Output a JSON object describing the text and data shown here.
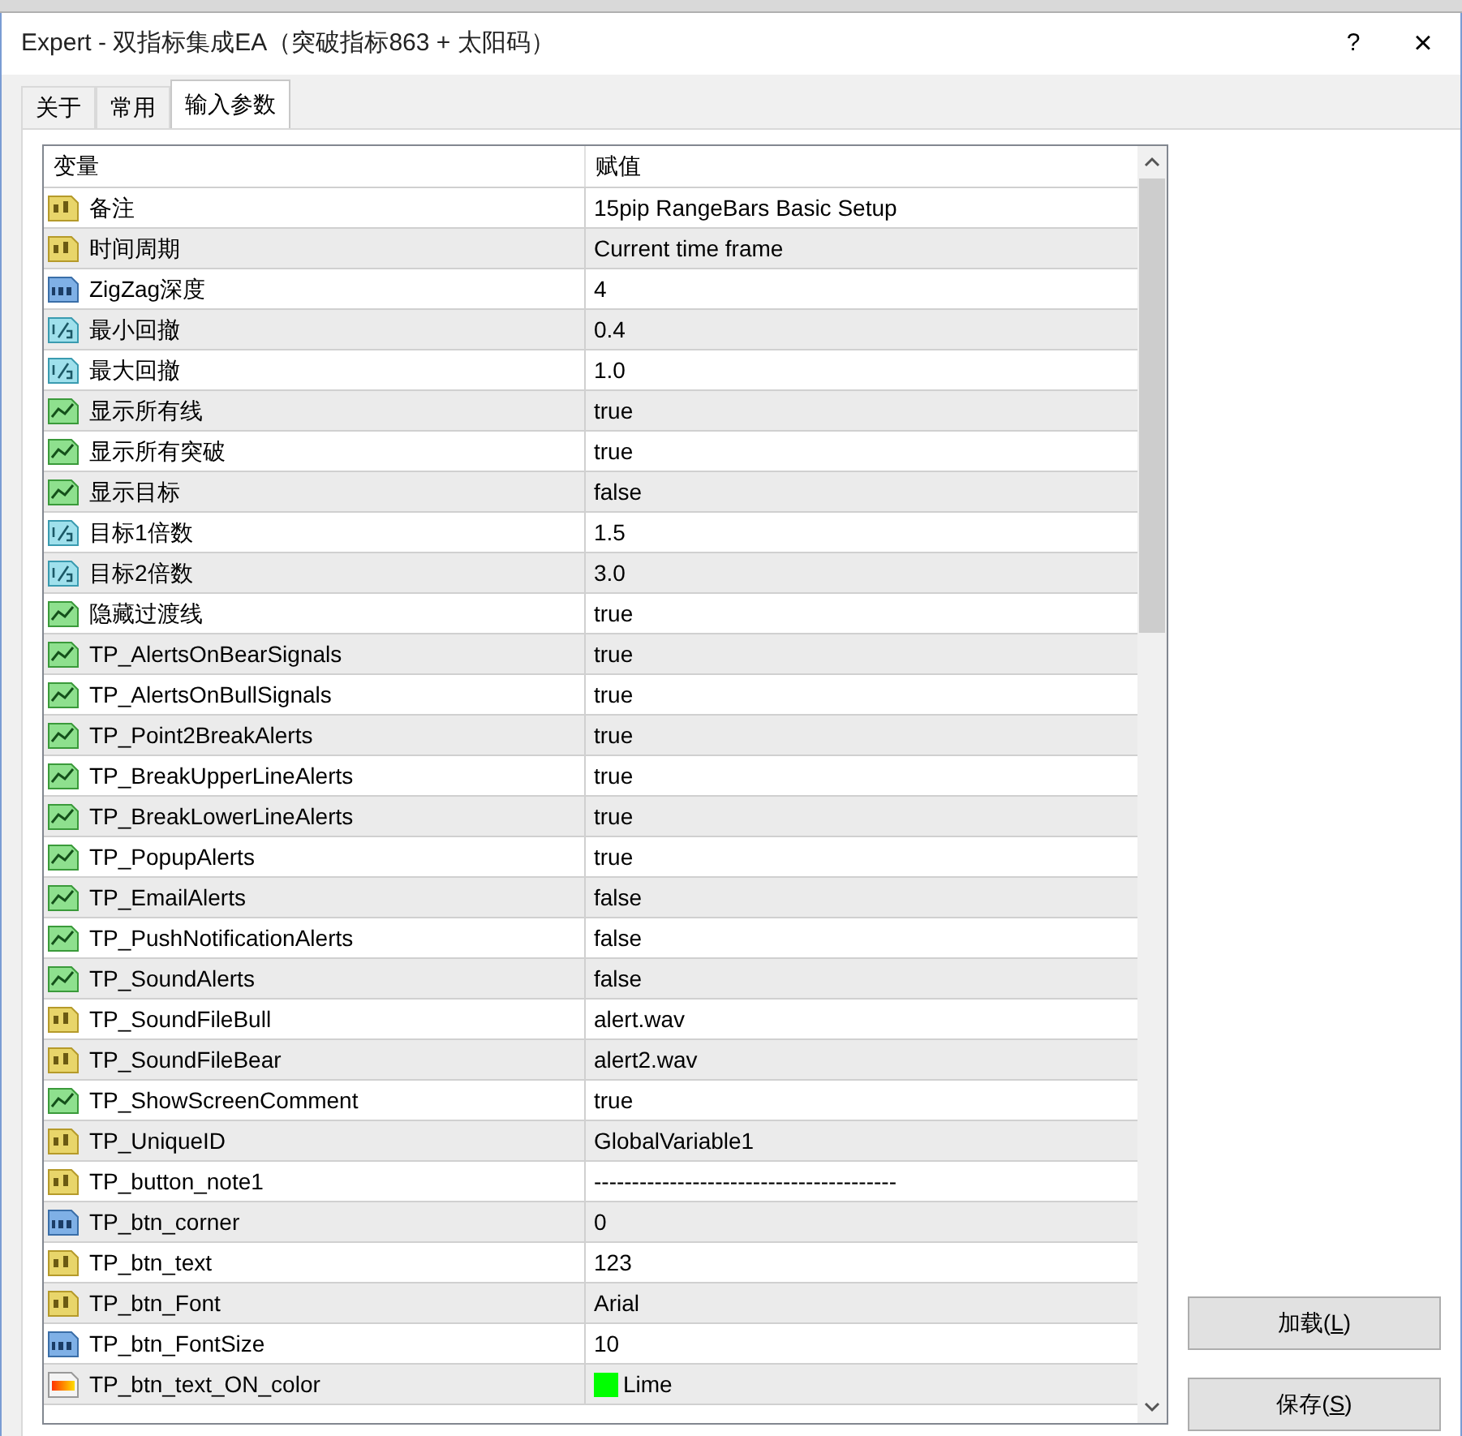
{
  "window": {
    "title": "Expert - 双指标集成EA（突破指标863 + 太阳码）",
    "help": "?",
    "close": "×"
  },
  "tabs": [
    {
      "label": "关于",
      "selected": false
    },
    {
      "label": "常用",
      "selected": false
    },
    {
      "label": "输入参数",
      "selected": true
    }
  ],
  "table": {
    "columns": [
      "变量",
      "赋值"
    ],
    "rows": [
      {
        "kind": "string",
        "name": "备注",
        "value": "15pip RangeBars Basic Setup"
      },
      {
        "kind": "string",
        "name": "时间周期",
        "value": "Current time frame"
      },
      {
        "kind": "int",
        "name": "ZigZag深度",
        "value": "4"
      },
      {
        "kind": "double",
        "name": "最小回撤",
        "value": "0.4"
      },
      {
        "kind": "double",
        "name": "最大回撤",
        "value": "1.0"
      },
      {
        "kind": "bool",
        "name": "显示所有线",
        "value": "true"
      },
      {
        "kind": "bool",
        "name": "显示所有突破",
        "value": "true"
      },
      {
        "kind": "bool",
        "name": "显示目标",
        "value": "false"
      },
      {
        "kind": "double",
        "name": "目标1倍数",
        "value": "1.5"
      },
      {
        "kind": "double",
        "name": "目标2倍数",
        "value": "3.0"
      },
      {
        "kind": "bool",
        "name": "隐藏过渡线",
        "value": "true"
      },
      {
        "kind": "bool",
        "name": "TP_AlertsOnBearSignals",
        "value": "true"
      },
      {
        "kind": "bool",
        "name": "TP_AlertsOnBullSignals",
        "value": "true"
      },
      {
        "kind": "bool",
        "name": "TP_Point2BreakAlerts",
        "value": "true"
      },
      {
        "kind": "bool",
        "name": "TP_BreakUpperLineAlerts",
        "value": "true"
      },
      {
        "kind": "bool",
        "name": "TP_BreakLowerLineAlerts",
        "value": "true"
      },
      {
        "kind": "bool",
        "name": "TP_PopupAlerts",
        "value": "true"
      },
      {
        "kind": "bool",
        "name": "TP_EmailAlerts",
        "value": "false"
      },
      {
        "kind": "bool",
        "name": "TP_PushNotificationAlerts",
        "value": "false"
      },
      {
        "kind": "bool",
        "name": "TP_SoundAlerts",
        "value": "false"
      },
      {
        "kind": "string",
        "name": "TP_SoundFileBull",
        "value": "alert.wav"
      },
      {
        "kind": "string",
        "name": "TP_SoundFileBear",
        "value": "alert2.wav"
      },
      {
        "kind": "bool",
        "name": "TP_ShowScreenComment",
        "value": "true"
      },
      {
        "kind": "string",
        "name": "TP_UniqueID",
        "value": "GlobalVariable1"
      },
      {
        "kind": "string",
        "name": "TP_button_note1",
        "value": "----------------------------------------"
      },
      {
        "kind": "int",
        "name": "TP_btn_corner",
        "value": "0"
      },
      {
        "kind": "string",
        "name": "TP_btn_text",
        "value": "123"
      },
      {
        "kind": "string",
        "name": "TP_btn_Font",
        "value": "Arial"
      },
      {
        "kind": "int",
        "name": "TP_btn_FontSize",
        "value": "10"
      },
      {
        "kind": "color",
        "name": "TP_btn_text_ON_color",
        "value": "Lime",
        "color": "#00ff00"
      }
    ]
  },
  "buttons": [
    {
      "label": "加载(",
      "key": "L",
      "end": ")"
    },
    {
      "label": "保存(",
      "key": "S",
      "end": ")"
    }
  ]
}
